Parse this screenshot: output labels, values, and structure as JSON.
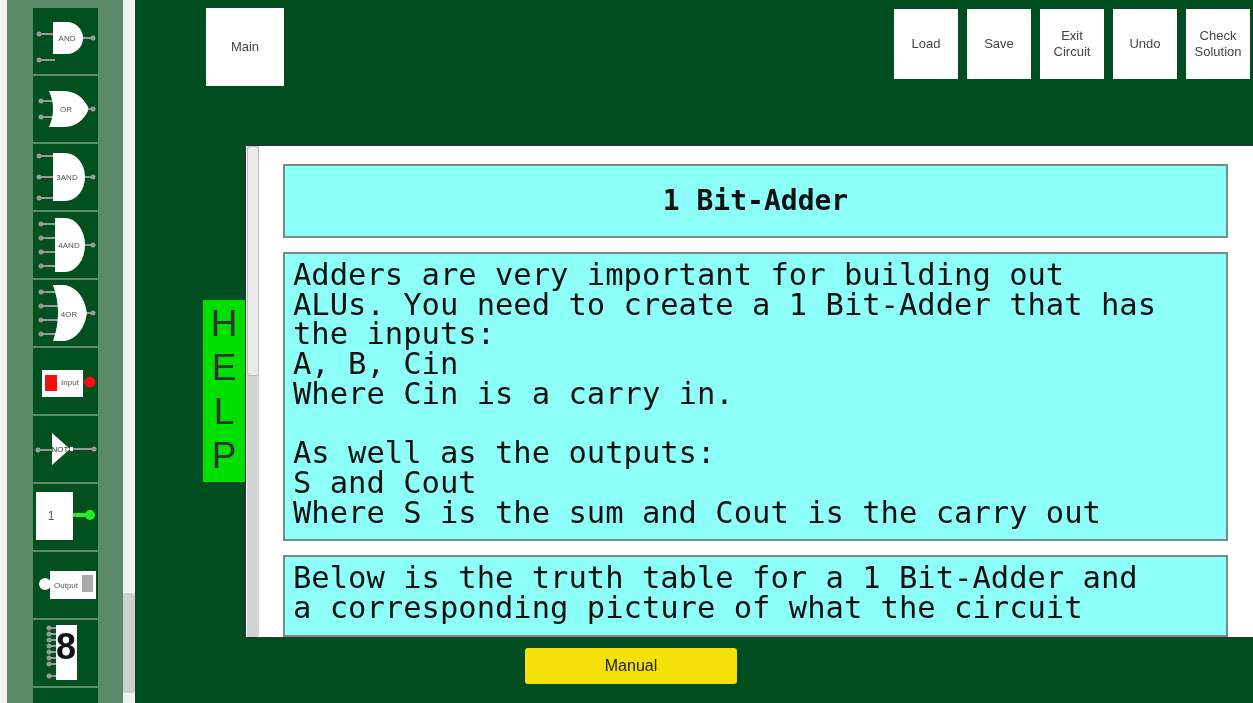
{
  "palette": [
    {
      "kind": "and",
      "label": "AND"
    },
    {
      "kind": "or",
      "label": "OR"
    },
    {
      "kind": "and3",
      "label": "3AND"
    },
    {
      "kind": "and4",
      "label": "4AND"
    },
    {
      "kind": "or4",
      "label": "4OR"
    },
    {
      "kind": "input",
      "label": "Input"
    },
    {
      "kind": "not",
      "label": "NOT"
    },
    {
      "kind": "const",
      "label": "1"
    },
    {
      "kind": "output",
      "label": "Output"
    },
    {
      "kind": "display",
      "label": "8"
    },
    {
      "kind": "empty"
    }
  ],
  "main_button": "Main",
  "toolbar": [
    "Load",
    "Save",
    "Exit\nCircuit",
    "Undo",
    "Check\nSolution"
  ],
  "help_tab": "HELP",
  "help": {
    "title": "1 Bit-Adder",
    "paragraphs": [
      "Adders are very important for building out\nALUs. You need to create a 1 Bit-Adder that has\nthe inputs:\nA, B, Cin\nWhere Cin is a carry in.\n\nAs well as the outputs:\nS and Cout\nWhere S is the sum and Cout is the carry out",
      "Below is the truth table for a 1 Bit-Adder and\na corresponding picture of what the circuit"
    ]
  },
  "manual_button": "Manual"
}
